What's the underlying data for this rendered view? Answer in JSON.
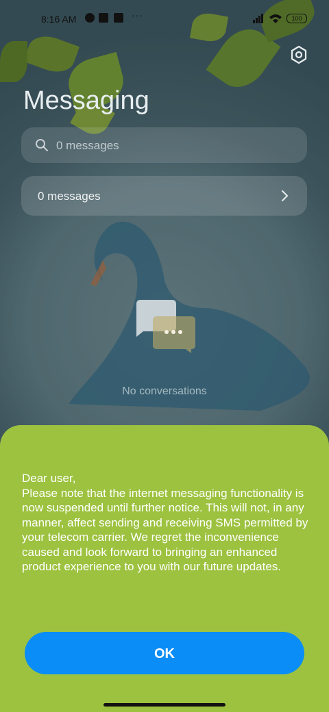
{
  "status_bar": {
    "time": "8:16 AM",
    "battery": "100",
    "overflow": "···"
  },
  "header": {
    "title": "Messaging",
    "settings_icon": "gear-icon"
  },
  "search": {
    "placeholder": "0 messages",
    "icon": "search-icon"
  },
  "messages_card": {
    "label": "0 messages",
    "icon": "chevron-right-icon"
  },
  "empty_state": {
    "text": "No conversations",
    "icon": "chat-bubbles-icon"
  },
  "dialog": {
    "message": "Dear user,\nPlease note that the internet messaging functionality is now suspended until further notice. This will not, in any manner, affect sending and receiving SMS permitted by your telecom carrier. We regret the inconvenience caused and look forward to bringing an enhanced product experience to you with our future updates.",
    "ok_label": "OK",
    "background_color": "#9dc240",
    "button_color": "#0a8df6"
  }
}
